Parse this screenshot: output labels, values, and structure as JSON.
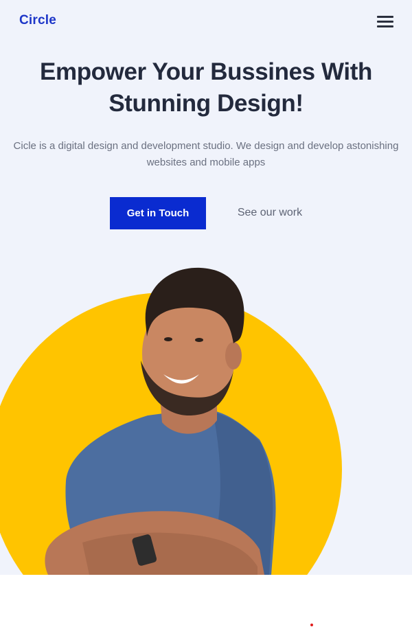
{
  "header": {
    "logo_text": "Circle",
    "menu_icon": "hamburger-menu-icon"
  },
  "hero": {
    "title": "Empower Your Bussines With Stunning Design!",
    "subtitle": "Cicle is a digital design and development studio. We design and develop astonishing websites and mobile apps",
    "primary_cta": "Get in Touch",
    "secondary_cta": "See our work",
    "image": "smiling-man-photo",
    "colors": {
      "background": "#f0f3fb",
      "accent": "#0a2bd0",
      "circle": "#ffc400",
      "heading": "#232a3d",
      "body_text": "#6a7080"
    }
  }
}
